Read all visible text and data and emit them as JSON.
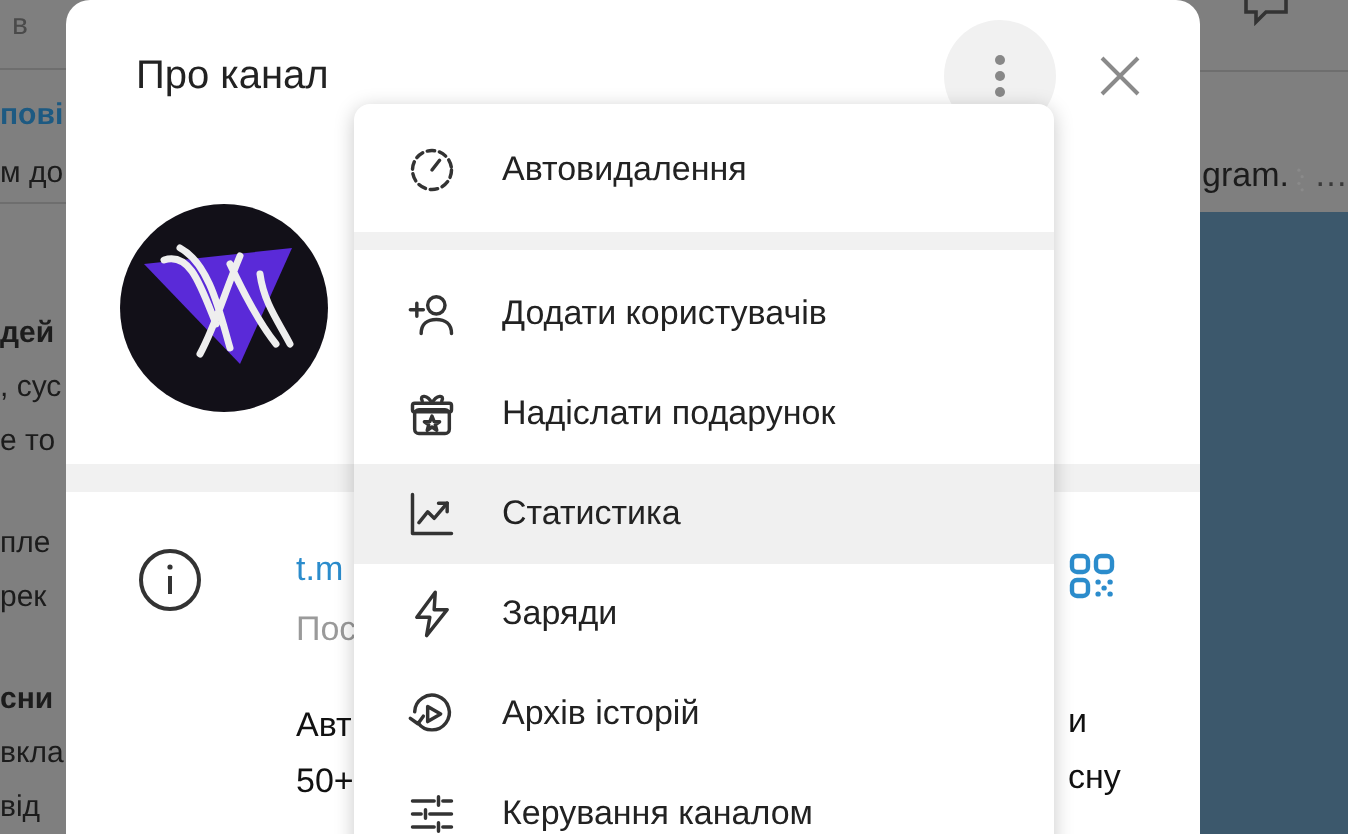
{
  "background": {
    "header_text": "в",
    "preview": [
      {
        "text": "пові",
        "kind": "link"
      },
      {
        "text": "м до",
        "kind": "plain"
      }
    ],
    "paragraphs": [
      [
        {
          "text": "дей",
          "bold": true
        },
        {
          "text": ", сус",
          "bold": false
        },
        {
          "text": "е то",
          "bold": false
        }
      ],
      [
        {
          "text": "пле",
          "bold": false
        },
        {
          "text": "рек",
          "bold": false
        }
      ],
      [
        {
          "text": "сни",
          "bold": true
        },
        {
          "text": "вкла",
          "bold": false
        },
        {
          "text": "від",
          "bold": false
        }
      ]
    ],
    "right_preview": {
      "text": "gram.",
      "trail": "…"
    }
  },
  "dialog": {
    "title": "Про канал",
    "info": {
      "link": "t.m",
      "subtitle": "Пос",
      "description": [
        {
          "left": "Авт",
          "right": "и"
        },
        {
          "left": "50+",
          "right": "сну"
        }
      ]
    }
  },
  "menu": {
    "groups": [
      [
        {
          "label": "Автовидалення",
          "highlighted": false
        }
      ],
      [
        {
          "label": "Додати користувачів",
          "highlighted": false
        },
        {
          "label": "Надіслати подарунок",
          "highlighted": false
        },
        {
          "label": "Статистика",
          "highlighted": true
        },
        {
          "label": "Заряди",
          "highlighted": false
        },
        {
          "label": "Архів історій",
          "highlighted": false
        },
        {
          "label": "Керування каналом",
          "highlighted": false
        }
      ]
    ]
  }
}
